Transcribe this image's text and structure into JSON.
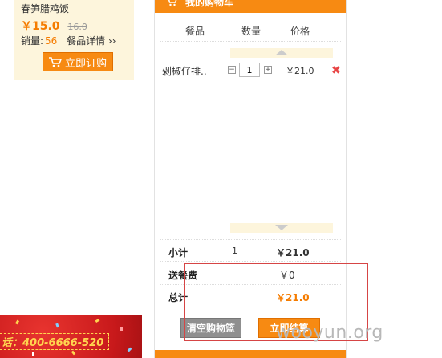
{
  "product": {
    "name": "春笋腊鸡饭",
    "price": "￥15.0",
    "old_price": "16.0",
    "sales_label": "销量:",
    "sales_count": "56",
    "detail_link": "餐品详情 ››",
    "order_button": "立即订购"
  },
  "cart": {
    "title": "我的购物车",
    "columns": {
      "name": "餐品",
      "qty": "数量",
      "price": "价格"
    },
    "items": [
      {
        "name": "剁椒仔排..",
        "qty": "1",
        "price": "￥21.0"
      }
    ],
    "summary": {
      "subtotal_label": "小计",
      "subtotal_count": "1",
      "subtotal_value": "￥21.0",
      "delivery_label": "送餐费",
      "delivery_value": "￥0",
      "total_label": "总计",
      "total_value": "￥21.0"
    },
    "clear_button": "清空购物篮",
    "checkout_button": "立即结算",
    "qty_minus": "−",
    "qty_plus": "+",
    "remove_icon": "✖"
  },
  "banner": {
    "text": "话：400-6666-520"
  },
  "watermark": "wooyun.org",
  "colors": {
    "accent": "#f78a12",
    "price": "#f57c00",
    "annotation": "#d64545"
  }
}
